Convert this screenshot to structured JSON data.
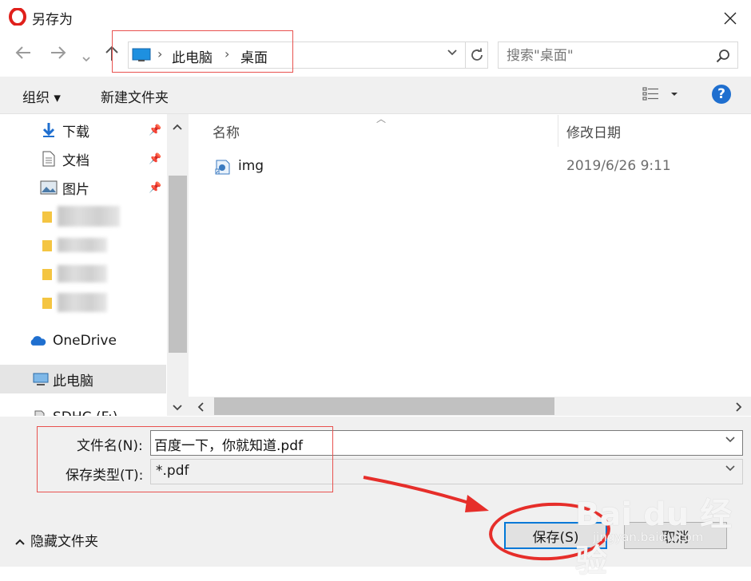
{
  "window": {
    "title": "另存为"
  },
  "address": {
    "breadcrumbs": [
      "此电脑",
      "桌面"
    ],
    "search_placeholder": "搜索\"桌面\""
  },
  "toolbar": {
    "organize": "组织 ▾",
    "new_folder": "新建文件夹",
    "help": "?"
  },
  "nav": {
    "items": [
      {
        "label": "下载",
        "icon": "download-arrow-icon",
        "pinned": true
      },
      {
        "label": "文档",
        "icon": "document-icon",
        "pinned": true
      },
      {
        "label": "图片",
        "icon": "picture-icon",
        "pinned": true
      },
      {
        "label": "OneDrive",
        "icon": "cloud-icon"
      },
      {
        "label": "此电脑",
        "icon": "computer-icon",
        "selected": true
      },
      {
        "label": "SDHC (F:)",
        "icon": "sd-card-icon"
      }
    ]
  },
  "filelist": {
    "columns": [
      "名称",
      "修改日期"
    ],
    "rows": [
      {
        "name": "img",
        "modified": "2019/6/26 9:11"
      }
    ]
  },
  "form": {
    "filename_label": "文件名(N):",
    "filename_value": "百度一下，你就知道.pdf",
    "type_label": "保存类型(T):",
    "type_value": "*.pdf"
  },
  "footer": {
    "hide_folders": "隐藏文件夹",
    "save": "保存(S)",
    "cancel": "取消"
  },
  "watermark": {
    "brand": "Bai du 经验",
    "site": "jingyan.baidu.com"
  },
  "colors": {
    "accent": "#0078d7",
    "annotation": "#e62e2a",
    "help": "#1f6fcf"
  }
}
